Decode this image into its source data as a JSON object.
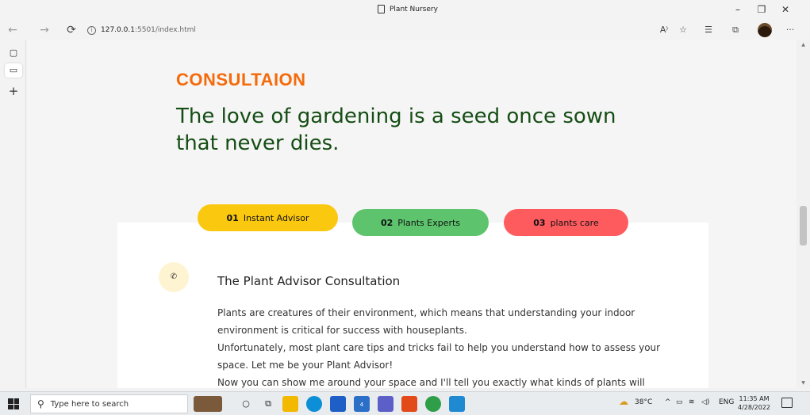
{
  "window": {
    "title": "Plant Nursery",
    "controls": {
      "minimize": "–",
      "restore": "❐",
      "close": "✕"
    }
  },
  "addressbar": {
    "back": "←",
    "forward": "→",
    "refresh": "⟳",
    "url_host": "127.0.0.1",
    "url_rest": ":5501/index.html",
    "tools": {
      "read_aloud": "A⁾",
      "favorite": "☆",
      "favorites": "☰",
      "collections": "⧉",
      "more": "···"
    }
  },
  "sidebar": {
    "tab_actions": "▢",
    "tab": "▭",
    "new_tab": "+"
  },
  "page": {
    "section_heading": "CONSULTAION",
    "quote": "The love of gardening is a seed once sown that never dies.",
    "tabs": [
      {
        "num": "01",
        "label": "Instant Advisor",
        "color": "#fbc810"
      },
      {
        "num": "02",
        "label": "Plants Experts",
        "color": "#5dc46d"
      },
      {
        "num": "03",
        "label": "plants care",
        "color": "#fe5b5f"
      }
    ],
    "phone_icon": "✆",
    "advisor_title": "The Plant Advisor Consultation",
    "advisor_paragraphs": [
      "Plants are creatures of their environment, which means that understanding your indoor environment is critical for success with houseplants.",
      "Unfortunately, most plant care tips and tricks fail to help you understand how to assess your space. Let me be your Plant Advisor!",
      "Now you can show me around your space and I'll tell you exactly what kinds of plants will"
    ]
  },
  "colors": {
    "accent_orange": "#f56a0a",
    "quote_green": "#154d14"
  },
  "taskbar": {
    "search_placeholder": "Type here to search",
    "weather": "38°C",
    "language": "ENG",
    "time": "11:35 AM",
    "date": "4/28/2022",
    "mail_badge": "4"
  }
}
